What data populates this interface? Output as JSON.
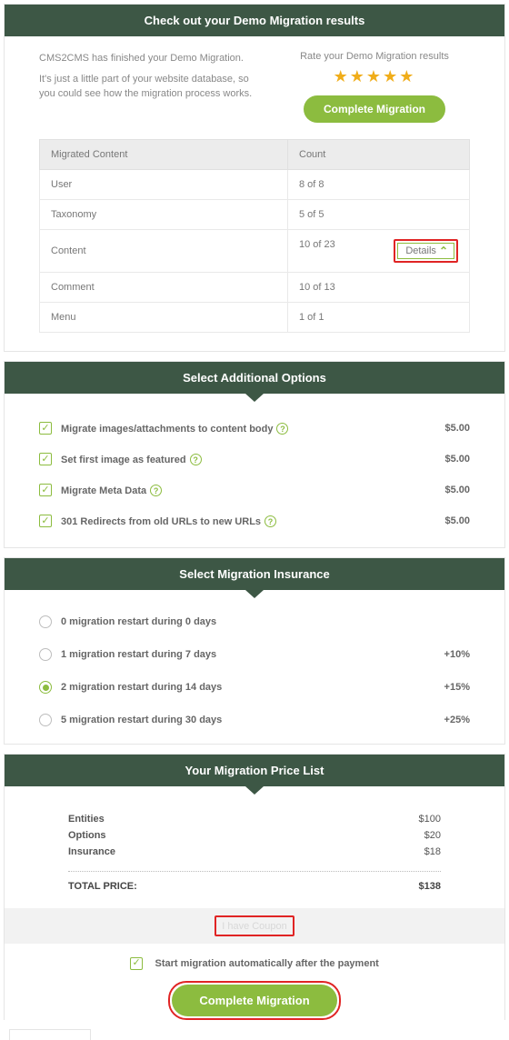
{
  "results": {
    "header": "Check out your Demo Migration results",
    "line1": "CMS2CMS has finished your Demo Migration.",
    "line2": "It's just a little part of your website database, so you could see how the migration process works.",
    "rateLabel": "Rate your Demo Migration results",
    "completeBtn": "Complete Migration",
    "table": {
      "colContent": "Migrated Content",
      "colCount": "Count",
      "rows": [
        {
          "name": "User",
          "count": "8 of 8"
        },
        {
          "name": "Taxonomy",
          "count": "5 of 5"
        },
        {
          "name": "Content",
          "count": "10 of 23",
          "details": "Details"
        },
        {
          "name": "Comment",
          "count": "10 of 13"
        },
        {
          "name": "Menu",
          "count": "1 of 1"
        }
      ]
    }
  },
  "options": {
    "header": "Select Additional Options",
    "items": [
      {
        "label": "Migrate images/attachments to content body",
        "price": "$5.00",
        "help": true
      },
      {
        "label": "Set first image as featured",
        "price": "$5.00",
        "help": true
      },
      {
        "label": "Migrate Meta Data",
        "price": "$5.00",
        "help": true
      },
      {
        "label": "301 Redirects from old URLs to new URLs",
        "price": "$5.00",
        "help": true
      }
    ]
  },
  "insurance": {
    "header": "Select Migration Insurance",
    "items": [
      {
        "label": "0 migration restart during 0 days",
        "price": ""
      },
      {
        "label": "1 migration restart during 7 days",
        "price": "+10%"
      },
      {
        "label": "2 migration restart during 14 days",
        "price": "+15%"
      },
      {
        "label": "5 migration restart during 30 days",
        "price": "+25%"
      }
    ],
    "selected": 2
  },
  "pricelist": {
    "header": "Your Migration Price List",
    "rows": [
      {
        "label": "Entities",
        "value": "$100"
      },
      {
        "label": "Options",
        "value": "$20"
      },
      {
        "label": "Insurance",
        "value": "$18"
      }
    ],
    "totalLabel": "TOTAL PRICE:",
    "totalValue": "$138",
    "coupon": "I have Coupon",
    "autoStart": "Start migration automatically after the payment",
    "completeBtn": "Complete Migration"
  }
}
